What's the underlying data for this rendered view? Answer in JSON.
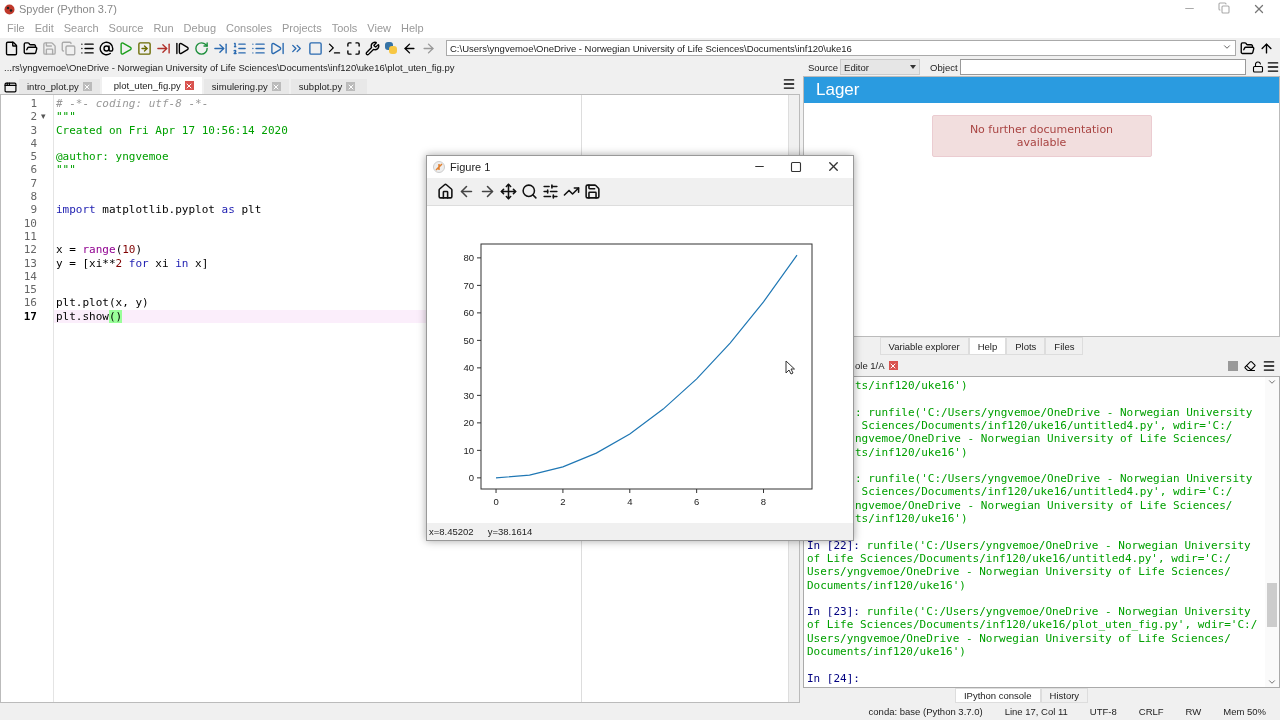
{
  "window": {
    "title": "Spyder (Python 3.7)"
  },
  "menu": [
    "File",
    "Edit",
    "Search",
    "Source",
    "Run",
    "Debug",
    "Consoles",
    "Projects",
    "Tools",
    "View",
    "Help"
  ],
  "path_field": {
    "value": "C:\\Users\\yngvemoe\\OneDrive - Norwegian University of Life Sciences\\Documents\\inf120\\uke16"
  },
  "file_path": "...rs\\yngvemoe\\OneDrive - Norwegian University of Life Sciences\\Documents\\inf120\\uke16\\plot_uten_fig.py",
  "editor_tabs": [
    {
      "label": "intro_plot.py",
      "selected": false
    },
    {
      "label": "plot_uten_fig.py",
      "selected": true
    },
    {
      "label": "simulering.py",
      "selected": false
    },
    {
      "label": "subplot.py",
      "selected": false
    }
  ],
  "editor_lines": [
    {
      "number": "1",
      "current": false,
      "tokens": [
        {
          "kind": "comment",
          "text": "# -*- coding: utf-8 -*-"
        }
      ]
    },
    {
      "number": "2",
      "current": false,
      "fold_marker": "▾",
      "tokens": [
        {
          "kind": "string",
          "text": "\"\"\""
        }
      ]
    },
    {
      "number": "3",
      "current": false,
      "tokens": [
        {
          "kind": "string",
          "text": "Created on Fri Apr 17 10:56:14 2020"
        }
      ]
    },
    {
      "number": "4",
      "current": false
    },
    {
      "number": "5",
      "current": false,
      "tokens": [
        {
          "kind": "string",
          "text": "@author: yngvemoe"
        }
      ]
    },
    {
      "number": "6",
      "current": false,
      "tokens": [
        {
          "kind": "string",
          "text": "\"\"\""
        }
      ]
    },
    {
      "number": "7",
      "current": false
    },
    {
      "number": "8",
      "current": false
    },
    {
      "number": "9",
      "current": false,
      "tokens": [
        {
          "kind": "keyword",
          "text": "import"
        },
        {
          "kind": "plain",
          "text": " matplotlib.pyplot "
        },
        {
          "kind": "keyword",
          "text": "as"
        },
        {
          "kind": "plain",
          "text": " plt"
        }
      ]
    },
    {
      "number": "10",
      "current": false
    },
    {
      "number": "11",
      "current": false
    },
    {
      "number": "12",
      "current": false,
      "tokens": [
        {
          "kind": "plain",
          "text": "x = "
        },
        {
          "kind": "builtin",
          "text": "range"
        },
        {
          "kind": "plain",
          "text": "("
        },
        {
          "kind": "number",
          "text": "10"
        },
        {
          "kind": "plain",
          "text": ")"
        }
      ]
    },
    {
      "number": "13",
      "current": false,
      "tokens": [
        {
          "kind": "plain",
          "text": "y = [xi**"
        },
        {
          "kind": "number",
          "text": "2"
        },
        {
          "kind": "keyword",
          "text": " for"
        },
        {
          "kind": "plain",
          "text": " xi "
        },
        {
          "kind": "keyword",
          "text": "in"
        },
        {
          "kind": "plain",
          "text": " x]"
        }
      ]
    },
    {
      "number": "14",
      "current": false
    },
    {
      "number": "15",
      "current": false
    },
    {
      "number": "16",
      "current": false,
      "tokens": [
        {
          "kind": "plain",
          "text": "plt.plot(x, y)"
        }
      ]
    },
    {
      "number": "17",
      "current": true,
      "tokens": [
        {
          "kind": "plain",
          "text": "plt.show"
        },
        {
          "kind": "match",
          "text": "()"
        }
      ]
    }
  ],
  "help": {
    "source_label": "Source",
    "source_value": "Editor",
    "object_label": "Object",
    "title": "Lager",
    "notice": "No further documentation available"
  },
  "pane_tabs": [
    {
      "label": "Variable explorer",
      "selected": false
    },
    {
      "label": "Help",
      "selected": true
    },
    {
      "label": "Plots",
      "selected": false
    },
    {
      "label": "Files",
      "selected": false
    }
  ],
  "console": {
    "tab": "ole 1/A",
    "clipped_blocks": [
      [
        "ts/inf120/uke16')"
      ],
      [
        ": runfile('C:/Users/yngvemoe/OneDrive - Norwegian University",
        " Sciences/Documents/inf120/uke16/untitled4.py', wdir='C:/",
        "ngvemoe/OneDrive - Norwegian University of Life Sciences/",
        "ts/inf120/uke16')"
      ],
      [
        ": runfile('C:/Users/yngvemoe/OneDrive - Norwegian University",
        " Sciences/Documents/inf120/uke16/untitled4.py', wdir='C:/",
        "ngvemoe/OneDrive - Norwegian University of Life Sciences/",
        "ts/inf120/uke16')"
      ]
    ],
    "blocks": [
      {
        "prompt": "In [22]:",
        "lines": [
          "runfile('C:/Users/yngvemoe/OneDrive - Norwegian University",
          "of Life Sciences/Documents/inf120/uke16/untitled4.py', wdir='C:/",
          "Users/yngvemoe/OneDrive - Norwegian University of Life Sciences/",
          "Documents/inf120/uke16')"
        ]
      },
      {
        "prompt": "In [23]:",
        "lines": [
          "runfile('C:/Users/yngvemoe/OneDrive - Norwegian University",
          "of Life Sciences/Documents/inf120/uke16/plot_uten_fig.py', wdir='C:/",
          "Users/yngvemoe/OneDrive - Norwegian University of Life Sciences/",
          "Documents/inf120/uke16')"
        ]
      },
      {
        "prompt": "In [24]:"
      }
    ]
  },
  "bottom_tabs": [
    {
      "label": "IPython console",
      "selected": true
    },
    {
      "label": "History",
      "selected": false
    }
  ],
  "status_bar": [
    "conda: base (Python 3.7.0)",
    "Line 17, Col 11",
    "UTF-8",
    "CRLF",
    "RW",
    "Mem 50%"
  ],
  "figure": {
    "title": "Figure 1",
    "x_reading": "x=8.45202",
    "y_reading": "y=38.1614",
    "chart_data": {
      "type": "line",
      "x": [
        0,
        1,
        2,
        3,
        4,
        5,
        6,
        7,
        8,
        9
      ],
      "series": [
        {
          "color": "#1f77b4",
          "values": [
            0,
            1,
            4,
            9,
            16,
            25,
            36,
            49,
            64,
            81
          ]
        }
      ],
      "xlim": [
        -0.45,
        9.45
      ],
      "ylim": [
        -4.05,
        85.05
      ],
      "xticks": [
        0,
        2,
        4,
        6,
        8
      ],
      "yticks": [
        0,
        10,
        20,
        30,
        40,
        50,
        60,
        70,
        80
      ]
    }
  }
}
